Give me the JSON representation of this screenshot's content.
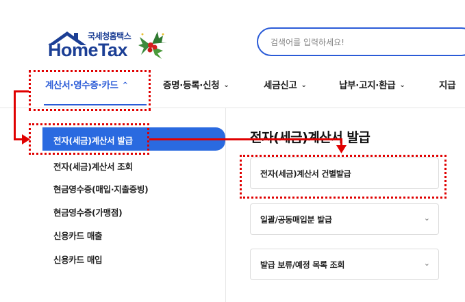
{
  "logo": {
    "sub_text": "국세청홈택스",
    "main_text": "HomeTax"
  },
  "search": {
    "placeholder": "검색어를 입력하세요!"
  },
  "nav": {
    "items": [
      {
        "label": "계산서·영수증·카드",
        "chevron": "^"
      },
      {
        "label": "증명·등록·신청",
        "chevron": "⌄"
      },
      {
        "label": "세금신고",
        "chevron": "⌄"
      },
      {
        "label": "납부·고지·환급",
        "chevron": "⌄"
      },
      {
        "label": "지급"
      }
    ]
  },
  "sidebar": {
    "items": [
      {
        "label": "전자(세금)계산서 발급",
        "active": true
      },
      {
        "label": "전자(세금)계산서 조회"
      },
      {
        "label": "현금영수증(매입·지출증빙)"
      },
      {
        "label": "현금영수증(가맹점)"
      },
      {
        "label": "신용카드 매출"
      },
      {
        "label": "신용카드 매입"
      }
    ]
  },
  "content": {
    "title": "전자(세금)계산서 발급",
    "cards": [
      {
        "label": "전자(세금)계산서 건별발급"
      },
      {
        "label": "일괄/공동매입분 발급",
        "chevron": "⌄"
      },
      {
        "label": "발급 보류/예정 목록 조회",
        "chevron": "⌄"
      }
    ]
  },
  "colors": {
    "accent": "#2a6ae0",
    "brand": "#1c3f95",
    "annotation": "#e00000"
  }
}
